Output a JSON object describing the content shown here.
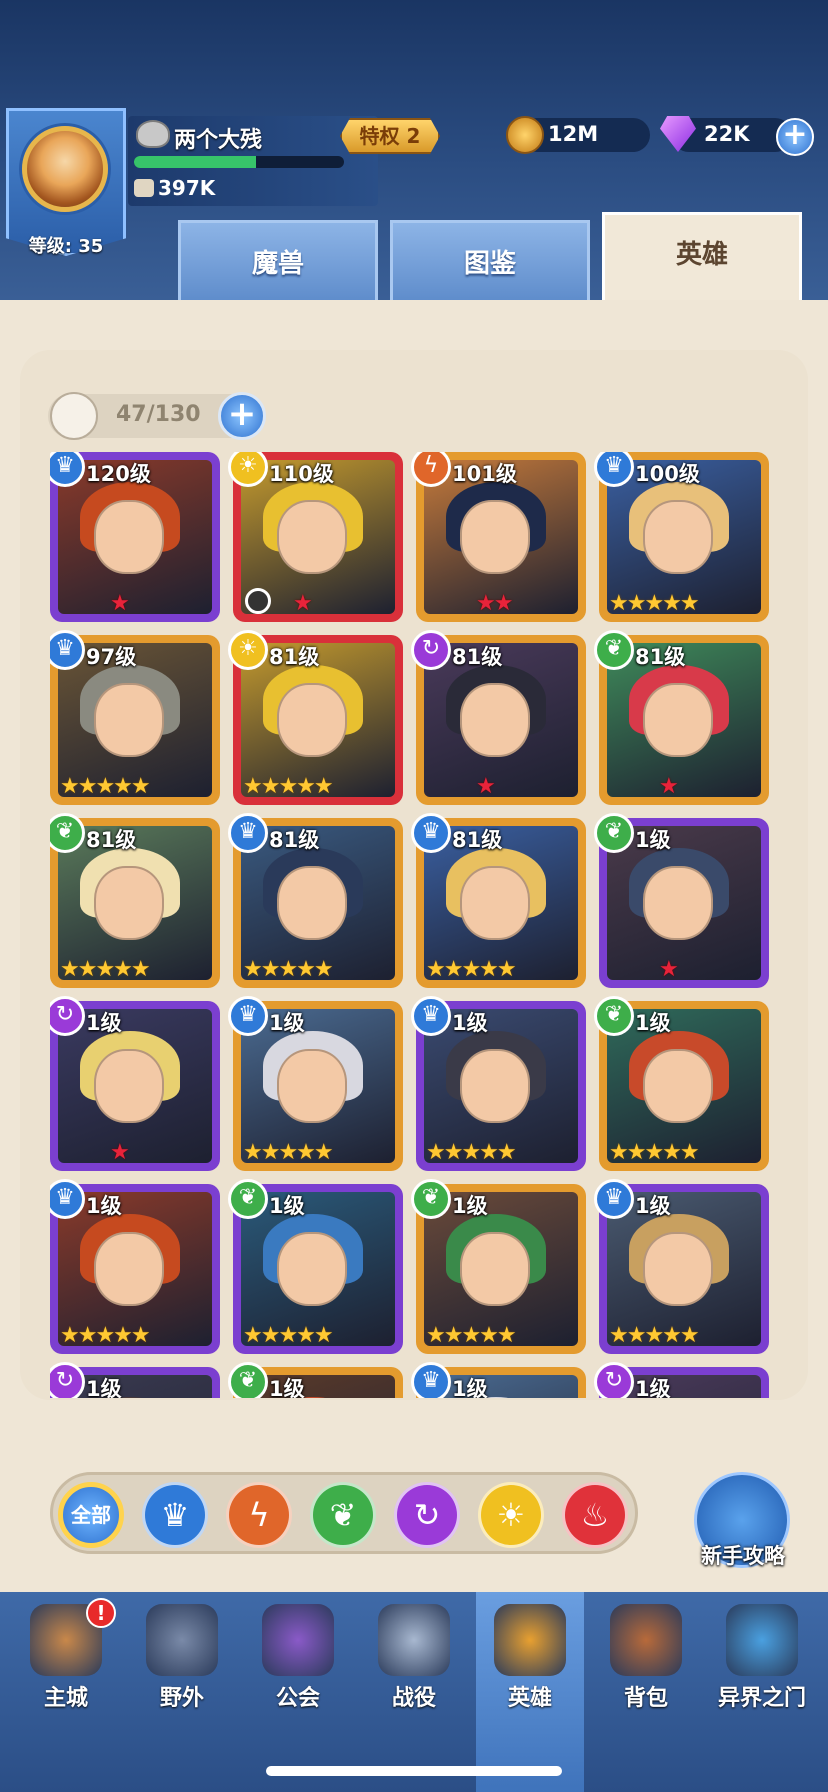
{
  "player": {
    "name": "两个大残",
    "privilege": "特权 2",
    "level_label": "等级: 35",
    "power": "397K",
    "xp_progress": 0.58
  },
  "currency": {
    "gold": "12M",
    "gems": "22K"
  },
  "tabs": [
    {
      "label": "魔兽",
      "active": false
    },
    {
      "label": "图鉴",
      "active": false
    },
    {
      "label": "英雄",
      "active": true
    }
  ],
  "hero_count": "47/130",
  "heroes": [
    {
      "level": "120级",
      "element": "crown-icon",
      "frame": "#7b3fd0",
      "stars": 1,
      "star_color": "red",
      "hair": "#c64a1f",
      "bg": "#8a3a2a"
    },
    {
      "level": "110级",
      "element": "sun-icon",
      "frame": "#d9303a",
      "stars": 1,
      "star_color": "red",
      "hair": "#e8c030",
      "bg": "#c49a2e",
      "timer": true
    },
    {
      "level": "101级",
      "element": "claw-icon",
      "frame": "#e49b2e",
      "stars": 2,
      "star_color": "red",
      "hair": "#1e2a4a",
      "bg": "#c57a3b"
    },
    {
      "level": "100级",
      "element": "crown-icon",
      "frame": "#e49b2e",
      "stars": 5,
      "star_color": "gold",
      "hair": "#e8c07a",
      "bg": "#3a5fa0"
    },
    {
      "level": "97级",
      "element": "crown-icon",
      "frame": "#e49b2e",
      "stars": 5,
      "star_color": "gold",
      "hair": "#8a8a80",
      "bg": "#6a5536"
    },
    {
      "level": "81级",
      "element": "sun-icon",
      "frame": "#d9303a",
      "stars": 5,
      "star_color": "gold",
      "hair": "#e8c030",
      "bg": "#c49a2e"
    },
    {
      "level": "81级",
      "element": "swirl-icon",
      "frame": "#e49b2e",
      "stars": 1,
      "star_color": "red",
      "hair": "#2a2a38",
      "bg": "#4a3a5a"
    },
    {
      "level": "81级",
      "element": "leaf-icon",
      "frame": "#e49b2e",
      "stars": 1,
      "star_color": "red",
      "hair": "#d83a4a",
      "bg": "#3f8a5a"
    },
    {
      "level": "81级",
      "element": "leaf-icon",
      "frame": "#e49b2e",
      "stars": 5,
      "star_color": "gold",
      "hair": "#f0e0b0",
      "bg": "#5a7a5a"
    },
    {
      "level": "81级",
      "element": "crown-icon",
      "frame": "#e49b2e",
      "stars": 5,
      "star_color": "gold",
      "hair": "#2a3a5a",
      "bg": "#3a5a80"
    },
    {
      "level": "81级",
      "element": "crown-icon",
      "frame": "#e49b2e",
      "stars": 5,
      "star_color": "gold",
      "hair": "#e8c060",
      "bg": "#3a5fa0"
    },
    {
      "level": "1级",
      "element": "leaf-icon",
      "frame": "#7b3fd0",
      "stars": 1,
      "star_color": "red",
      "hair": "#3a4a6a",
      "bg": "#4a3a4a"
    },
    {
      "level": "1级",
      "element": "swirl-icon",
      "frame": "#7b3fd0",
      "stars": 1,
      "star_color": "red",
      "hair": "#e8d070",
      "bg": "#3a3a60"
    },
    {
      "level": "1级",
      "element": "crown-icon",
      "frame": "#e49b2e",
      "stars": 5,
      "star_color": "gold",
      "hair": "#d8d8e0",
      "bg": "#4a6a90"
    },
    {
      "level": "1级",
      "element": "crown-icon",
      "frame": "#7b3fd0",
      "stars": 5,
      "star_color": "gold",
      "hair": "#3a3a48",
      "bg": "#3a4a70"
    },
    {
      "level": "1级",
      "element": "leaf-icon",
      "frame": "#e49b2e",
      "stars": 5,
      "star_color": "gold",
      "hair": "#c84a2a",
      "bg": "#2f6a5a"
    },
    {
      "level": "1级",
      "element": "crown-icon",
      "frame": "#7b3fd0",
      "stars": 5,
      "star_color": "gold",
      "hair": "#c64a1f",
      "bg": "#8a3a2a"
    },
    {
      "level": "1级",
      "element": "leaf-icon",
      "frame": "#7b3fd0",
      "stars": 5,
      "star_color": "gold",
      "hair": "#3a7ac0",
      "bg": "#2a5a7a"
    },
    {
      "level": "1级",
      "element": "leaf-icon",
      "frame": "#e49b2e",
      "stars": 5,
      "star_color": "gold",
      "hair": "#3a8a4a",
      "bg": "#6a4a3a"
    },
    {
      "level": "1级",
      "element": "crown-icon",
      "frame": "#7b3fd0",
      "stars": 5,
      "star_color": "gold",
      "hair": "#c8a060",
      "bg": "#4a5a70"
    },
    {
      "level": "1级",
      "element": "swirl-icon",
      "frame": "#7b3fd0",
      "stars": 0,
      "star_color": "gold",
      "hair": "#4a3a3a",
      "bg": "#3a3a50"
    },
    {
      "level": "1级",
      "element": "leaf-icon",
      "frame": "#e49b2e",
      "stars": 0,
      "star_color": "gold",
      "hair": "#c84a2a",
      "bg": "#5a3a2a"
    },
    {
      "level": "1级",
      "element": "crown-icon",
      "frame": "#e49b2e",
      "stars": 0,
      "star_color": "gold",
      "hair": "#d8d8e0",
      "bg": "#4a6a90"
    },
    {
      "level": "1级",
      "element": "swirl-icon",
      "frame": "#7b3fd0",
      "stars": 0,
      "star_color": "gold",
      "hair": "#3a3a48",
      "bg": "#4a3a5a"
    }
  ],
  "filters": [
    {
      "label": "全部",
      "icon": "all",
      "color": "#2e71cf"
    },
    {
      "label": "",
      "icon": "crown-icon",
      "color": "#2f7ad8"
    },
    {
      "label": "",
      "icon": "claw-icon",
      "color": "#e0662a"
    },
    {
      "label": "",
      "icon": "leaf-icon",
      "color": "#3eae4a"
    },
    {
      "label": "",
      "icon": "swirl-icon",
      "color": "#9a3ad8"
    },
    {
      "label": "",
      "icon": "sun-icon",
      "color": "#f0c020"
    },
    {
      "label": "",
      "icon": "flame-icon",
      "color": "#e0323a"
    }
  ],
  "guide_label": "新手攻略",
  "nav": [
    {
      "label": "主城",
      "icon": "castle-icon",
      "color": "#c9884a"
    },
    {
      "label": "野外",
      "icon": "sword-stone-icon",
      "color": "#7a8aa8"
    },
    {
      "label": "公会",
      "icon": "tower-icon",
      "color": "#8a5ac8"
    },
    {
      "label": "战役",
      "icon": "crossed-swords-icon",
      "color": "#a8b8d0"
    },
    {
      "label": "英雄",
      "icon": "helmet-icon",
      "color": "#e8a030"
    },
    {
      "label": "背包",
      "icon": "backpack-icon",
      "color": "#b86a3a"
    },
    {
      "label": "异界之门",
      "icon": "portal-icon",
      "color": "#4aa0e0"
    }
  ],
  "nav_badge": "!"
}
